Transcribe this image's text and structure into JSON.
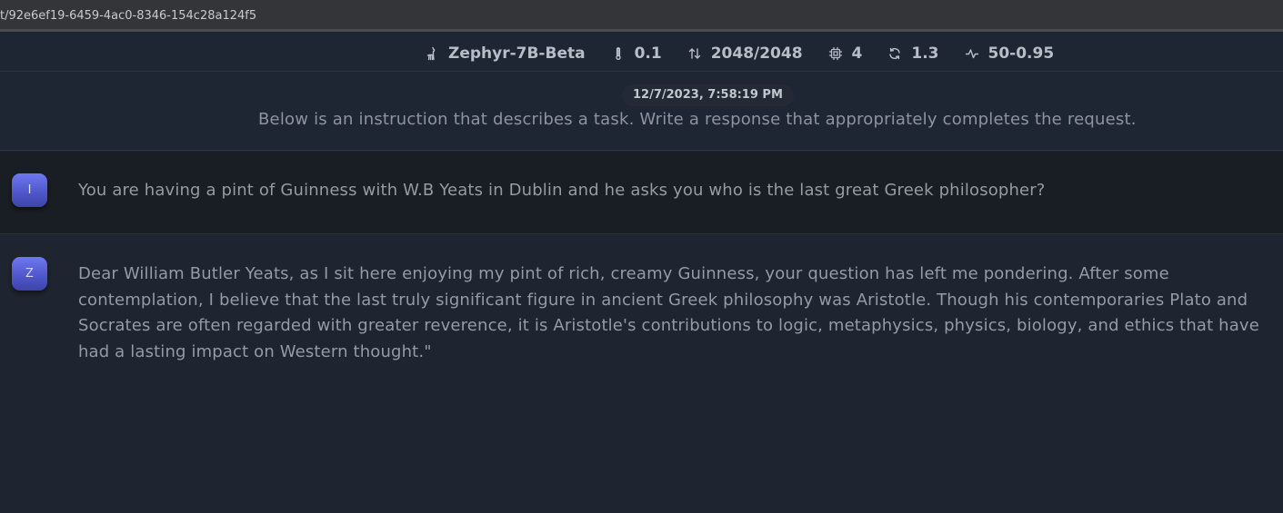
{
  "browser": {
    "url": "t/92e6ef19-6459-4ac0-8346-154c28a124f5"
  },
  "model_bar": {
    "model_name": "Zephyr-7B-Beta",
    "temperature": "0.1",
    "tokens": "2048/2048",
    "threads": "4",
    "repeat_penalty": "1.3",
    "top_k_top_p": "50-0.95",
    "icons": [
      "llama-icon",
      "thermometer-icon",
      "arrows-up-down-icon",
      "cpu-icon",
      "refresh-icon",
      "activity-icon"
    ]
  },
  "system": {
    "timestamp": "12/7/2023, 7:58:19 PM",
    "prompt": "Below is an instruction that describes a task. Write a response that appropriately completes the request."
  },
  "messages": [
    {
      "role": "user",
      "avatar_letter": "I",
      "text": "You are having a pint of Guinness with W.B Yeats in Dublin and he asks you who is the last great Greek philosopher?"
    },
    {
      "role": "assistant",
      "avatar_letter": "Z",
      "text": "Dear William Butler Yeats, as I sit here enjoying my pint of rich, creamy Guinness, your question has left me pondering. After some contemplation, I believe that the last truly significant figure in ancient Greek philosophy was Aristotle. Though his contemporaries Plato and Socrates are often regarded with greater reverence, it is Aristotle's contributions to logic, metaphysics, physics, biology, and ethics that have had a lasting impact on Western thought.\""
    }
  ],
  "colors": {
    "background": "#1e2430",
    "user_message_bg": "#191d24",
    "avatar_accent": "#5a62dc",
    "text": "#949ba5"
  }
}
